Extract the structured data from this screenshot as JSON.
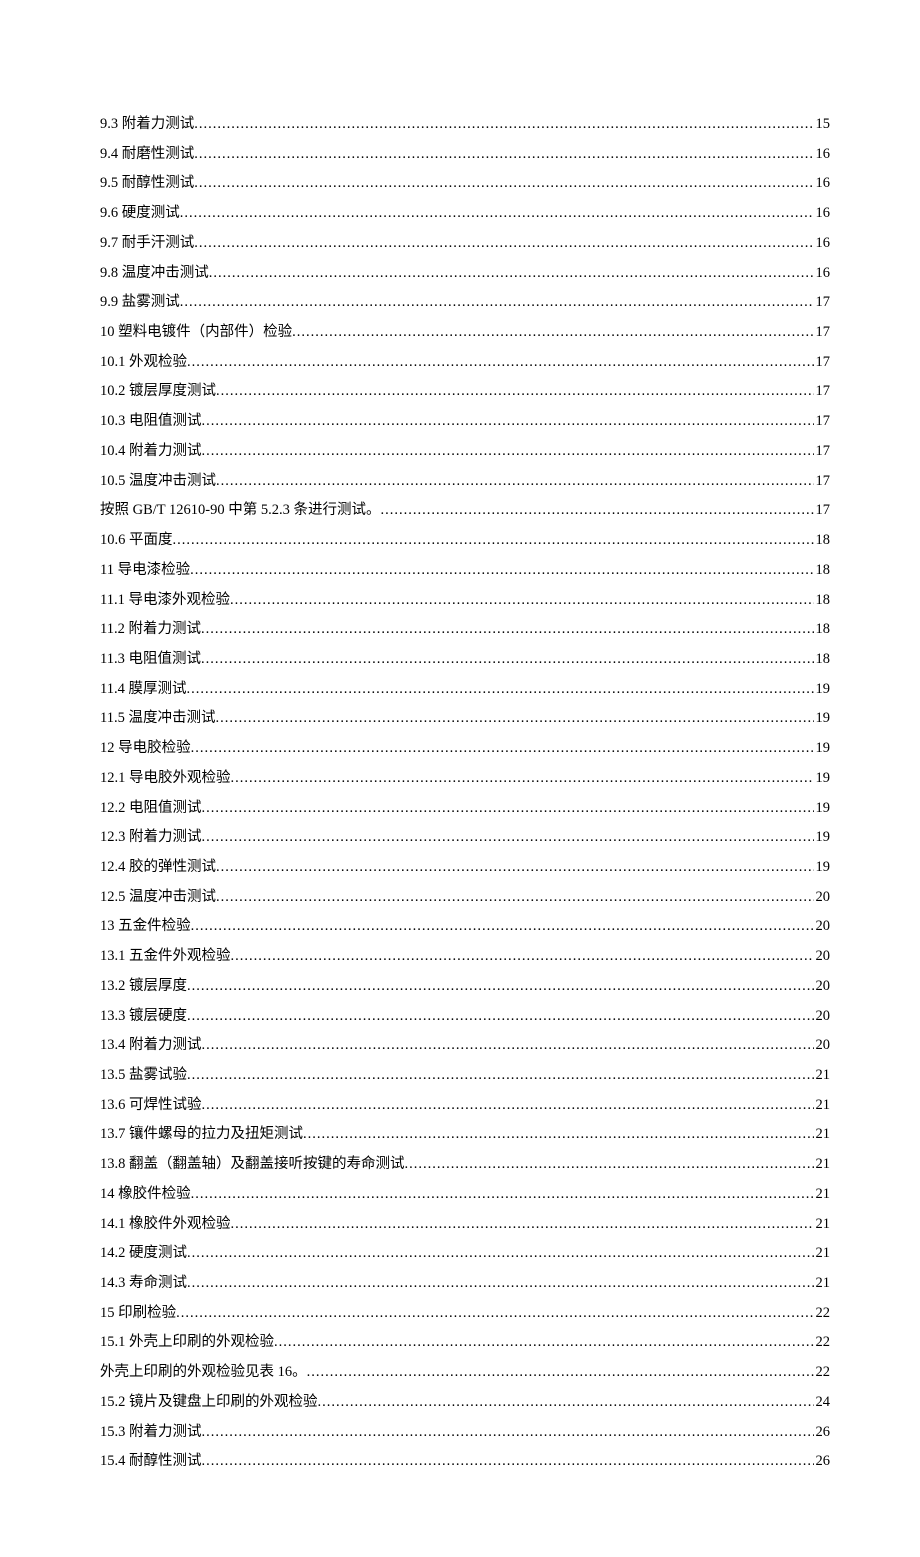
{
  "toc": [
    {
      "label": "9.3 附着力测试",
      "page": "15"
    },
    {
      "label": "9.4 耐磨性测试",
      "page": "16"
    },
    {
      "label": "9.5 耐醇性测试",
      "page": "16"
    },
    {
      "label": "9.6 硬度测试",
      "page": "16"
    },
    {
      "label": "9.7 耐手汗测试",
      "page": "16"
    },
    {
      "label": "9.8 温度冲击测试",
      "page": "16"
    },
    {
      "label": "9.9 盐雾测试",
      "page": "17"
    },
    {
      "label": "10 塑料电镀件（内部件）检验",
      "page": "17"
    },
    {
      "label": "10.1 外观检验",
      "page": "17"
    },
    {
      "label": "10.2 镀层厚度测试",
      "page": "17"
    },
    {
      "label": "10.3 电阻值测试",
      "page": "17"
    },
    {
      "label": "10.4 附着力测试",
      "page": "17"
    },
    {
      "label": "10.5 温度冲击测试",
      "page": "17"
    },
    {
      "label": "按照 GB/T 12610-90 中第 5.2.3 条进行测试。",
      "page": "17"
    },
    {
      "label": "10.6 平面度",
      "page": "18"
    },
    {
      "label": "11 导电漆检验",
      "page": "18"
    },
    {
      "label": "11.1 导电漆外观检验",
      "page": "18"
    },
    {
      "label": "11.2 附着力测试",
      "page": "18"
    },
    {
      "label": "11.3 电阻值测试",
      "page": "18"
    },
    {
      "label": "11.4 膜厚测试",
      "page": "19"
    },
    {
      "label": "11.5 温度冲击测试",
      "page": "19"
    },
    {
      "label": "12 导电胶检验",
      "page": "19"
    },
    {
      "label": "12.1 导电胶外观检验",
      "page": "19"
    },
    {
      "label": "12.2 电阻值测试",
      "page": "19"
    },
    {
      "label": "12.3 附着力测试",
      "page": "19"
    },
    {
      "label": "12.4 胶的弹性测试",
      "page": "19"
    },
    {
      "label": "12.5 温度冲击测试",
      "page": "20"
    },
    {
      "label": "13 五金件检验",
      "page": "20"
    },
    {
      "label": "13.1 五金件外观检验",
      "page": "20"
    },
    {
      "label": "13.2 镀层厚度",
      "page": "20"
    },
    {
      "label": "13.3 镀层硬度",
      "page": "20"
    },
    {
      "label": "13.4 附着力测试",
      "page": "20"
    },
    {
      "label": "13.5 盐雾试验",
      "page": "21"
    },
    {
      "label": "13.6 可焊性试验",
      "page": "21"
    },
    {
      "label": "13.7 镶件螺母的拉力及扭矩测试",
      "page": "21"
    },
    {
      "label": "13.8 翻盖（翻盖轴）及翻盖接听按键的寿命测试",
      "page": "21"
    },
    {
      "label": "14 橡胶件检验",
      "page": "21"
    },
    {
      "label": "14.1 橡胶件外观检验",
      "page": "21"
    },
    {
      "label": "14.2 硬度测试",
      "page": "21"
    },
    {
      "label": "14.3 寿命测试",
      "page": "21"
    },
    {
      "label": "15 印刷检验",
      "page": "22"
    },
    {
      "label": "15.1 外壳上印刷的外观检验",
      "page": "22"
    },
    {
      "label": "外壳上印刷的外观检验见表 16。",
      "page": "22"
    },
    {
      "label": "15.2 镜片及键盘上印刷的外观检验",
      "page": "24"
    },
    {
      "label": "15.3 附着力测试",
      "page": "26"
    },
    {
      "label": "15.4 耐醇性测试",
      "page": "26"
    }
  ]
}
